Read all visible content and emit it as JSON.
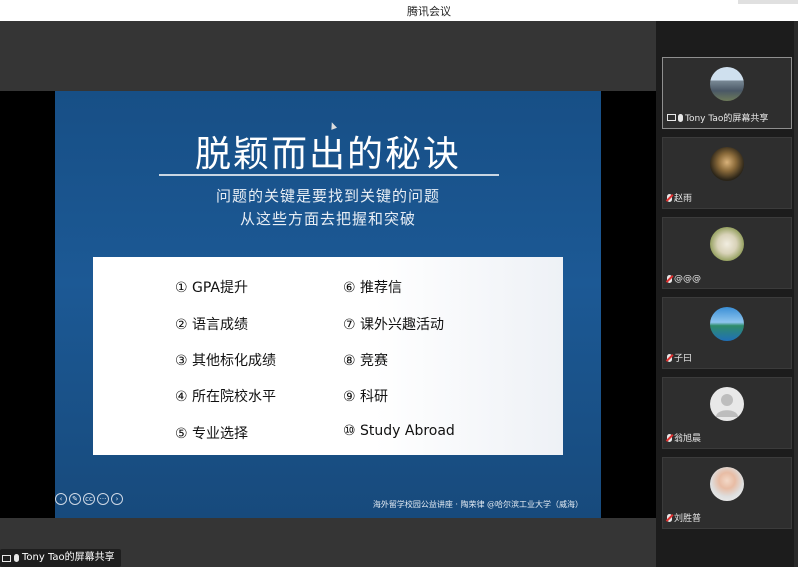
{
  "window": {
    "title": "腾讯会议"
  },
  "slide": {
    "title": "脱颖而出的秘诀",
    "subtitle_1": "问题的关键是要找到关键的问题",
    "subtitle_2": "从这些方面去把握和突破",
    "items_left": [
      "① GPA提升",
      "② 语言成绩",
      "③ 其他标化成绩",
      "④ 所在院校水平",
      "⑤ 专业选择"
    ],
    "items_right": [
      "⑥ 推荐信",
      "⑦ 课外兴趣活动",
      "⑧ 竞赛",
      "⑨ 科研",
      "⑩ Study Abroad"
    ],
    "footer": "海外留学校园公益讲座 · 陶荣律 @哈尔滨工业大学（威海）"
  },
  "share_label": "Tony Tao的屏幕共享",
  "participants": [
    {
      "name": "Tony Tao的屏幕共享",
      "avatar": "city-photo",
      "active": true
    },
    {
      "name": "赵雨",
      "avatar": "portrait-painting"
    },
    {
      "name": "@@@",
      "avatar": "cat-photo"
    },
    {
      "name": "子曰",
      "avatar": "landscape-photo"
    },
    {
      "name": "翁旭晨",
      "avatar": "default-avatar"
    },
    {
      "name": "刘胜普",
      "avatar": "person-photo"
    }
  ],
  "icons": [
    "share-screen-icon",
    "mic-icon",
    "mic-muted-icon",
    "prev-icon",
    "pen-icon",
    "cc-icon",
    "more-icon",
    "next-icon"
  ],
  "colors": {
    "slide_bg": "#1c5995",
    "sidebar_bg": "#1c1c1c",
    "muted_red": "#e03030"
  }
}
